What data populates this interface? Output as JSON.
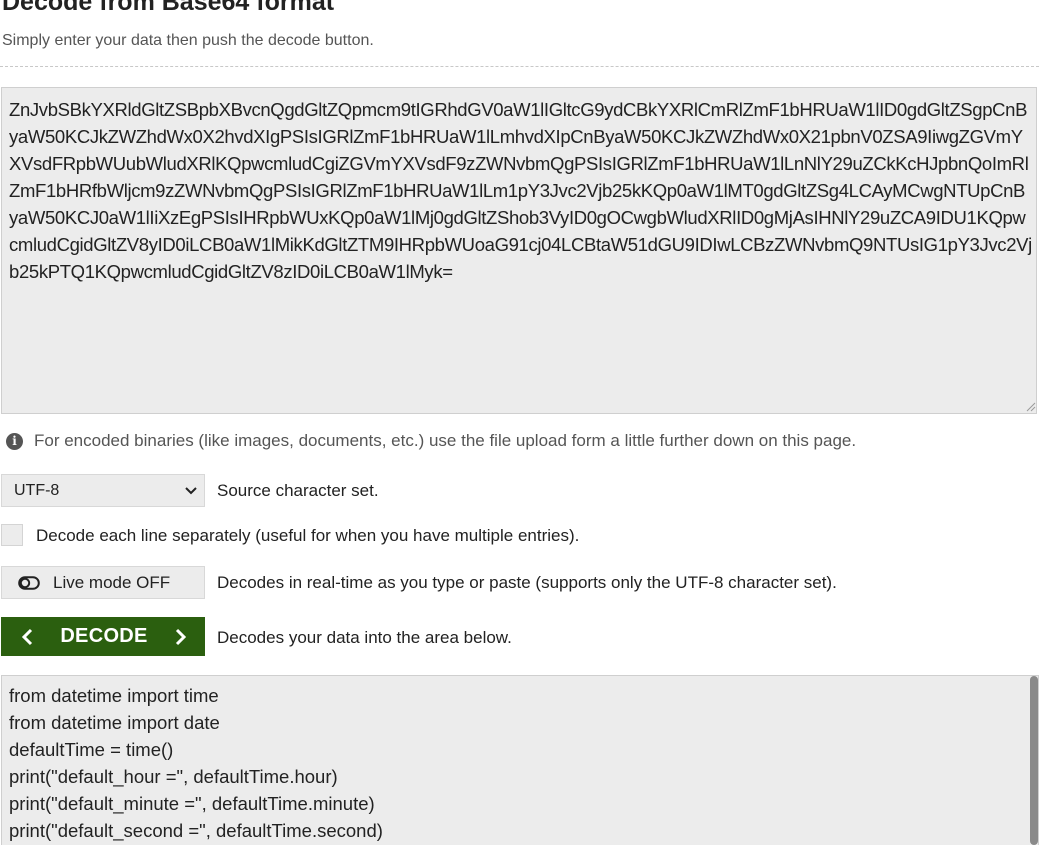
{
  "header": {
    "title": "Decode from Base64 format",
    "subtitle": "Simply enter your data then push the decode button."
  },
  "input": {
    "value": "ZnJvbSBkYXRldGltZSBpbXBvcnQgdGltZQpmcm9tIGRhdGV0aW1lIGltcG9ydCBkYXRlCmRlZmF1bHRUaW1lID0gdGltZSgpCnByaW50KCJkZWZhdWx0X2hvdXIgPSIsIGRlZmF1bHRUaW1lLmhvdXIpCnByaW50KCJkZWZhdWx0X21pbnV0ZSA9IiwgZGVmYXVsdFRpbWUubWludXRlKQpwcmludCgiZGVmYXVsdF9zZWNvbmQgPSIsIGRlZmF1bHRUaW1lLnNlY29uZCkKcHJpbnQoImRlZmF1bHRfbWljcm9zZWNvbmQgPSIsIGRlZmF1bHRUaW1lLm1pY3Jvc2Vjb25kKQp0aW1lMT0gdGltZSg4LCAyMCwgNTUpCnByaW50KCJ0aW1lIiXzEgPSIsIHRpbWUxKQp0aW1lMj0gdGltZShob3VyID0gOCwgbWludXRlID0gMjAsIHNlY29uZCA9IDU1KQpwcmludCgidGltZV8yID0iLCB0aW1lMikKdGltZTM9IHRpbWUoaG91cj04LCBtaW51dGU9IDIwLCBzZWNvbmQ9NTUsIG1pY3Jvc2Vjb25kPTQ1KQpwcmludCgidGltZV8zID0iLCB0aW1lMyk="
  },
  "info": {
    "text": "For encoded binaries (like images, documents, etc.) use the file upload form a little further down on this page."
  },
  "options": {
    "charset_value": "UTF-8",
    "charset_label": "Source character set.",
    "separate_lines_label": "Decode each line separately (useful for when you have multiple entries).",
    "live_mode_label": "Live mode OFF",
    "live_mode_desc": "Decodes in real-time as you type or paste (supports only the UTF-8 character set).",
    "decode_label": "DECODE",
    "decode_desc": "Decodes your data into the area below."
  },
  "output": {
    "lines": [
      "from datetime import time",
      "from datetime import date",
      "defaultTime = time()",
      "print(\"default_hour =\", defaultTime.hour)",
      "print(\"default_minute =\", defaultTime.minute)",
      "print(\"default_second =\", defaultTime.second)"
    ]
  },
  "colors": {
    "decode_button_bg": "#2b5f0f",
    "field_bg": "#ececec"
  },
  "icons": {
    "info": "info-circle-icon",
    "select_arrow": "chevron-down-icon",
    "toggle": "toggle-off-icon",
    "decode_left": "chevron-left-icon",
    "decode_right": "chevron-right-icon"
  }
}
